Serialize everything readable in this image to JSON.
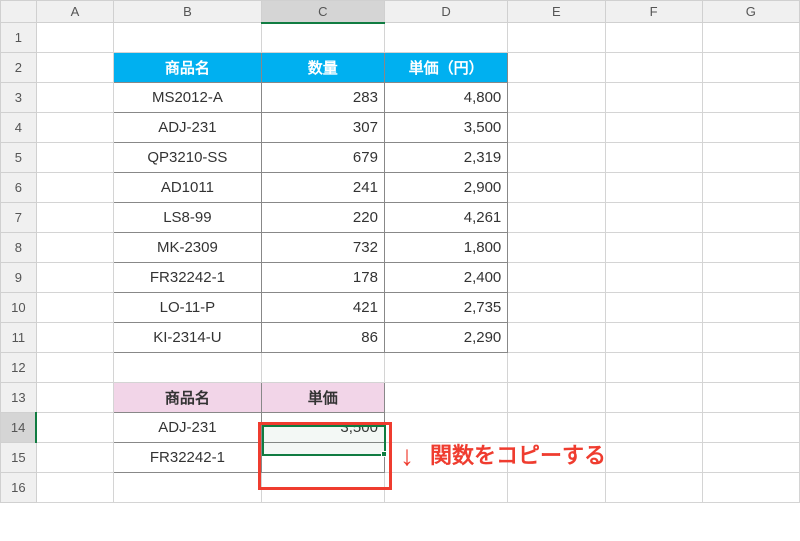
{
  "columns": [
    "A",
    "B",
    "C",
    "D",
    "E",
    "F",
    "G"
  ],
  "rows": [
    "1",
    "2",
    "3",
    "4",
    "5",
    "6",
    "7",
    "8",
    "9",
    "10",
    "11",
    "12",
    "13",
    "14",
    "15",
    "16"
  ],
  "table1": {
    "headers": {
      "name": "商品名",
      "qty": "数量",
      "price": "単価（円）"
    },
    "data": [
      {
        "name": "MS2012-A",
        "qty": "283",
        "price": "4,800"
      },
      {
        "name": "ADJ-231",
        "qty": "307",
        "price": "3,500"
      },
      {
        "name": "QP3210-SS",
        "qty": "679",
        "price": "2,319"
      },
      {
        "name": "AD1011",
        "qty": "241",
        "price": "2,900"
      },
      {
        "name": "LS8-99",
        "qty": "220",
        "price": "4,261"
      },
      {
        "name": "MK-2309",
        "qty": "732",
        "price": "1,800"
      },
      {
        "name": "FR32242-1",
        "qty": "178",
        "price": "2,400"
      },
      {
        "name": "LO-11-P",
        "qty": "421",
        "price": "2,735"
      },
      {
        "name": "KI-2314-U",
        "qty": "86",
        "price": "2,290"
      }
    ]
  },
  "table2": {
    "headers": {
      "name": "商品名",
      "price": "単価"
    },
    "data": [
      {
        "name": "ADJ-231",
        "price": "3,500"
      },
      {
        "name": "FR32242-1",
        "price": ""
      }
    ]
  },
  "annotation": {
    "text": "関数をコピーする",
    "arrow": "↓"
  },
  "selected_column": "C",
  "selected_row": "14"
}
